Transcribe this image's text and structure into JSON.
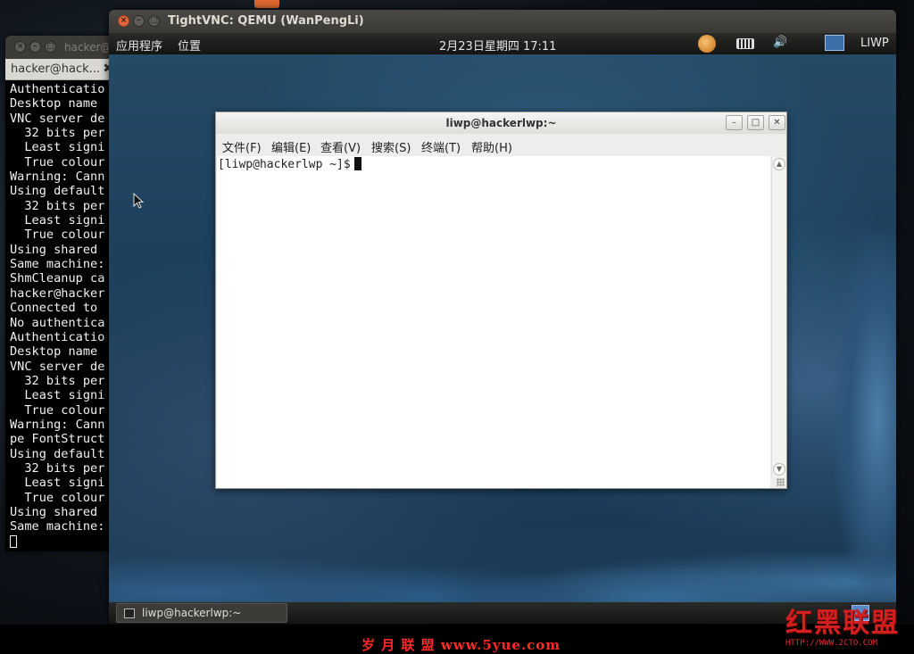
{
  "bg_terminal": {
    "title": "hacker@",
    "tab_label": "hacker@hack...",
    "tab_close": "✖",
    "lines": [
      "Authenticatio",
      "Desktop name ",
      "VNC server de",
      "  32 bits per",
      "  Least signi",
      "  True colour",
      "Warning: Cann",
      "Using default",
      "  32 bits per",
      "  Least signi",
      "  True colour",
      "Using shared ",
      "Same machine:",
      "ShmCleanup ca",
      "hacker@hacker",
      "Connected to ",
      "No authentica",
      "Authenticatio",
      "Desktop name ",
      "VNC server de",
      "  32 bits per",
      "  Least signi",
      "  True colour",
      "Warning: Cann",
      "pe FontStruct",
      "Using default",
      "  32 bits per",
      "  Least signi",
      "  True colour",
      "Using shared ",
      "Same machine:"
    ]
  },
  "vnc": {
    "title": "TightVNC: QEMU (WanPengLi)",
    "panel": {
      "applications": "应用程序",
      "places": "位置",
      "clock": "2月23日星期四 17:11",
      "user": "LIWP"
    },
    "taskbar": {
      "task_label": "liwp@hackerlwp:~"
    }
  },
  "gnome_terminal": {
    "title": "liwp@hackerlwp:~",
    "menus": [
      "文件(F)",
      "编辑(E)",
      "查看(V)",
      "搜索(S)",
      "终端(T)",
      "帮助(H)"
    ],
    "prompt": "[liwp@hackerlwp ~]$",
    "buttons": {
      "minimize": "–",
      "maximize": "□",
      "close": "✕"
    }
  },
  "watermark": {
    "center": "岁 月 联 盟   www.5yue.com",
    "logo_text": "红黑联盟",
    "logo_url": "HTTP://WWW.2CTO.COM"
  },
  "colors": {
    "close_button": "#e1673d",
    "panel_bg": "#1d1d1b",
    "watermark_red": "#ff2a2a"
  }
}
